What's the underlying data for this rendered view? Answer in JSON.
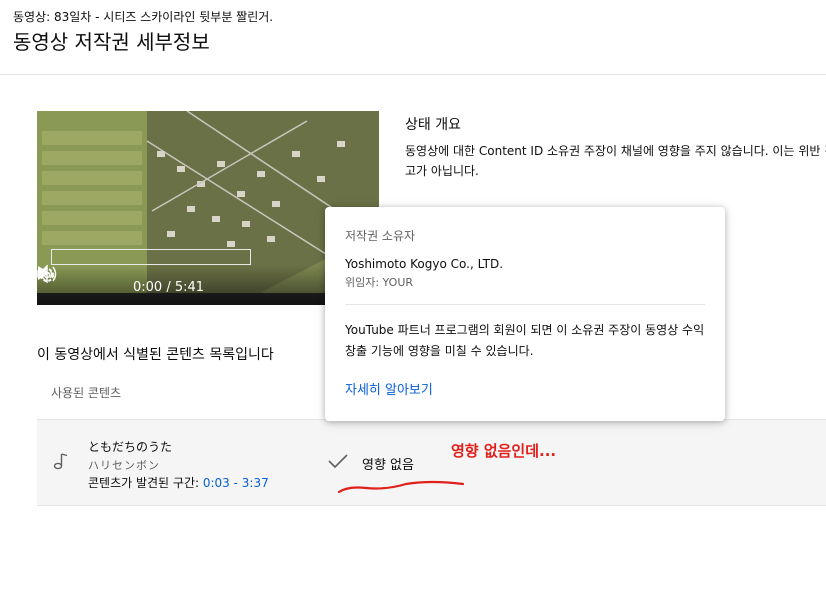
{
  "header": {
    "subtitle": "동영상: 83일차 - 시티즈 스카이라인 뒷부분 짤린거.",
    "title": "동영상 저작권 세부정보"
  },
  "player": {
    "time": "0:00 / 5:41",
    "icons": [
      "play-icon",
      "volume-icon",
      "settings-gear-icon"
    ]
  },
  "status": {
    "title": "상태 개요",
    "text": "동영상에 대한 Content ID 소유권 주장이 채널에 영향을 주지 않습니다. 이는 위반 경고가 아닙니다."
  },
  "content_list": {
    "title": "이 동영상에서 식별된 콘텐츠 목록입니다",
    "column_used": "사용된 콘텐츠",
    "rows": [
      {
        "song": "ともだちのうた",
        "artist": "ハリセンボン",
        "found_label": "콘텐츠가 발견된 구간: ",
        "found_range": "0:03 - 3:37",
        "impact": "영향 없음"
      }
    ]
  },
  "popup": {
    "label": "저작권 소유자",
    "owner": "Yoshimoto Kogyo Co., LTD.",
    "delegate": "위임자: YOUR",
    "text": "YouTube 파트너 프로그램의 회원이 되면 이 소유권 주장이 동영상 수익 창출 기능에 영향을 미칠 수 있습니다.",
    "learn_more": "자세히 알아보기"
  },
  "annotation": {
    "text": "영향 없음인데...",
    "color": "#e0201b"
  },
  "colors": {
    "link": "#065fd4",
    "row_bg": "#f5f5f5"
  }
}
